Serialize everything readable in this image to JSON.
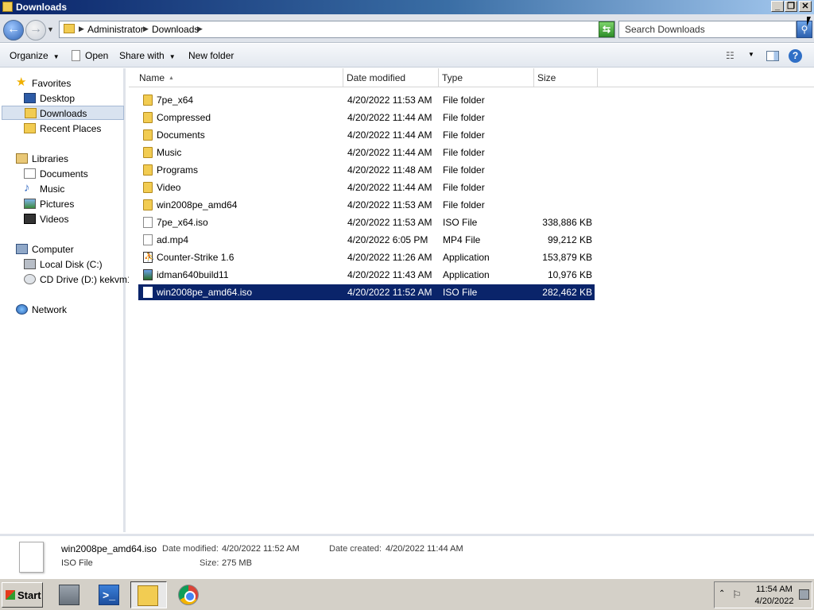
{
  "window": {
    "title": "Downloads"
  },
  "address": {
    "crumbs": [
      "Administrator",
      "Downloads"
    ],
    "search_placeholder": "Search Downloads"
  },
  "toolbar": {
    "organize": "Organize",
    "open": "Open",
    "share_with": "Share with",
    "new_folder": "New folder"
  },
  "nav": {
    "favorites": "Favorites",
    "desktop": "Desktop",
    "downloads": "Downloads",
    "recent_places": "Recent Places",
    "libraries": "Libraries",
    "documents": "Documents",
    "music": "Music",
    "pictures": "Pictures",
    "videos": "Videos",
    "computer": "Computer",
    "local_disk": "Local Disk (C:)",
    "cd_drive": "CD Drive (D:) kekvm1",
    "network": "Network"
  },
  "columns": {
    "name": "Name",
    "date_modified": "Date modified",
    "type": "Type",
    "size": "Size"
  },
  "files": [
    {
      "name": "7pe_x64",
      "date": "4/20/2022 11:53 AM",
      "type": "File folder",
      "size": "",
      "icon": "folder-icon"
    },
    {
      "name": "Compressed",
      "date": "4/20/2022 11:44 AM",
      "type": "File folder",
      "size": "",
      "icon": "folder-icon"
    },
    {
      "name": "Documents",
      "date": "4/20/2022 11:44 AM",
      "type": "File folder",
      "size": "",
      "icon": "folder-icon"
    },
    {
      "name": "Music",
      "date": "4/20/2022 11:44 AM",
      "type": "File folder",
      "size": "",
      "icon": "folder-icon"
    },
    {
      "name": "Programs",
      "date": "4/20/2022 11:48 AM",
      "type": "File folder",
      "size": "",
      "icon": "folder-icon"
    },
    {
      "name": "Video",
      "date": "4/20/2022 11:44 AM",
      "type": "File folder",
      "size": "",
      "icon": "folder-icon"
    },
    {
      "name": "win2008pe_amd64",
      "date": "4/20/2022 11:53 AM",
      "type": "File folder",
      "size": "",
      "icon": "folder-icon"
    },
    {
      "name": "7pe_x64.iso",
      "date": "4/20/2022 11:53 AM",
      "type": "ISO File",
      "size": "338,886 KB",
      "icon": "file-icon"
    },
    {
      "name": "ad.mp4",
      "date": "4/20/2022 6:05 PM",
      "type": "MP4 File",
      "size": "99,212 KB",
      "icon": "file-icon"
    },
    {
      "name": "Counter-Strike 1.6",
      "date": "4/20/2022 11:26 AM",
      "type": "Application",
      "size": "153,879 KB",
      "icon": "counter-strike-icon"
    },
    {
      "name": "idman640build11",
      "date": "4/20/2022 11:43 AM",
      "type": "Application",
      "size": "10,976 KB",
      "icon": "application-icon"
    },
    {
      "name": "win2008pe_amd64.iso",
      "date": "4/20/2022 11:52 AM",
      "type": "ISO File",
      "size": "282,462 KB",
      "icon": "file-icon",
      "selected": true
    }
  ],
  "details": {
    "name": "win2008pe_amd64.iso",
    "type": "ISO File",
    "date_modified_label": "Date modified:",
    "date_modified": "4/20/2022 11:52 AM",
    "date_created_label": "Date created:",
    "date_created": "4/20/2022 11:44 AM",
    "size_label": "Size:",
    "size": "275 MB"
  },
  "taskbar": {
    "start": "Start",
    "time": "11:54 AM",
    "date": "4/20/2022"
  },
  "colors": {
    "selection": "#0a246a",
    "titlebar": "#0a246a"
  }
}
